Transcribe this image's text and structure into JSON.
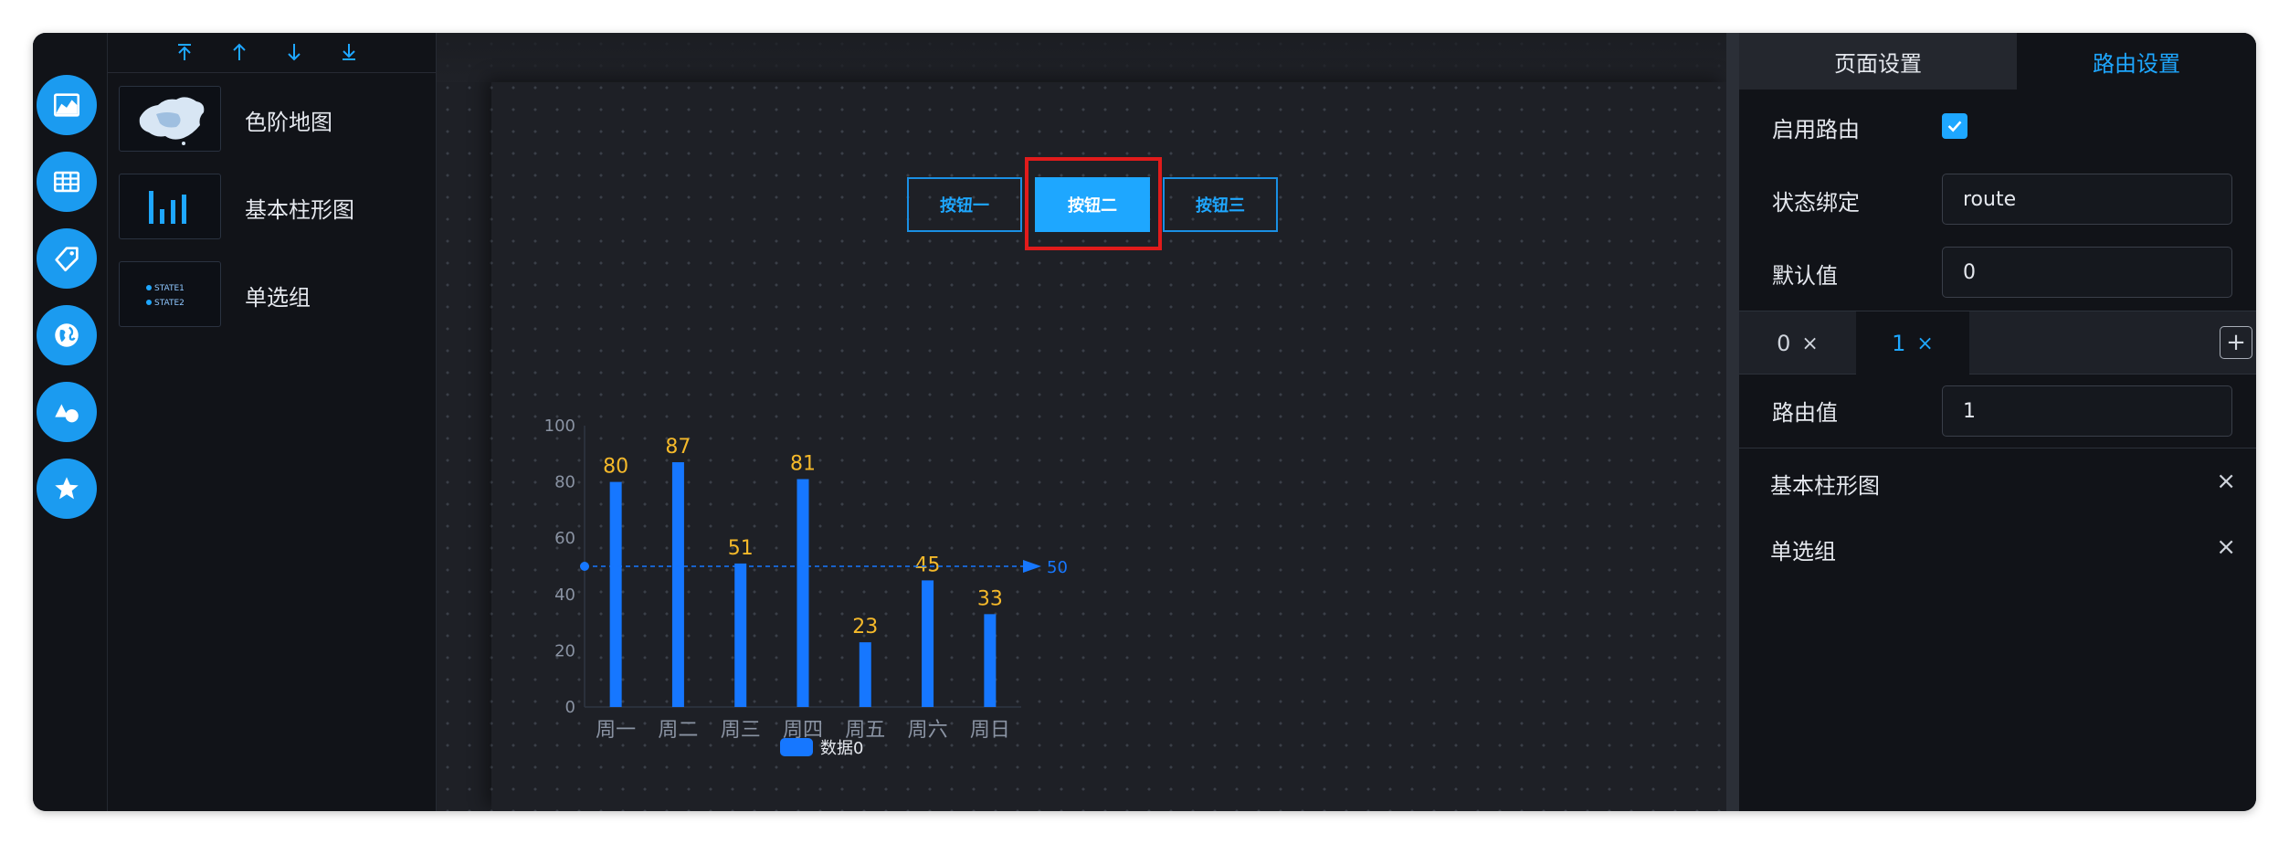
{
  "rail": {
    "icons": [
      "area-chart-icon",
      "table-icon",
      "tag-icon",
      "globe-icon",
      "shapes-icon",
      "star-icon"
    ]
  },
  "component_list": {
    "sort_icons": [
      "move-top-icon",
      "move-up-icon",
      "move-down-icon",
      "move-bottom-icon"
    ],
    "items": [
      {
        "label": "色阶地图"
      },
      {
        "label": "基本柱形图"
      },
      {
        "label": "单选组",
        "thumb_lines": [
          "STATE1",
          "STATE2"
        ]
      }
    ]
  },
  "canvas": {
    "buttons": [
      {
        "label": "按钮一",
        "active": false
      },
      {
        "label": "按钮二",
        "active": true
      },
      {
        "label": "按钮三",
        "active": false
      }
    ]
  },
  "chart_data": {
    "type": "bar",
    "categories": [
      "周一",
      "周二",
      "周三",
      "周四",
      "周五",
      "周六",
      "周日"
    ],
    "series": [
      {
        "name": "数据0",
        "values": [
          80,
          87,
          51,
          81,
          23,
          45,
          33
        ]
      }
    ],
    "ylim": [
      0,
      100
    ],
    "yticks": [
      0,
      20,
      40,
      60,
      80,
      100
    ],
    "markline": {
      "value": 50,
      "label": "50"
    },
    "colors": {
      "bar": "#1677ff",
      "label": "#f5b92a",
      "axis": "#8a93a3"
    }
  },
  "right_panel": {
    "tabs": {
      "page": "页面设置",
      "route": "路由设置"
    },
    "enable_route": {
      "label": "启用路由",
      "checked": true
    },
    "state_binding": {
      "label": "状态绑定",
      "value": "route"
    },
    "default_value": {
      "label": "默认值",
      "value": "0"
    },
    "route_tabs": [
      {
        "label": "0",
        "close": "×"
      },
      {
        "label": "1",
        "close": "×"
      }
    ],
    "add_label": "+",
    "route_value": {
      "label": "路由值",
      "value": "1"
    },
    "bound_components": [
      {
        "label": "基本柱形图",
        "remove": "×"
      },
      {
        "label": "单选组",
        "remove": "×"
      }
    ]
  }
}
